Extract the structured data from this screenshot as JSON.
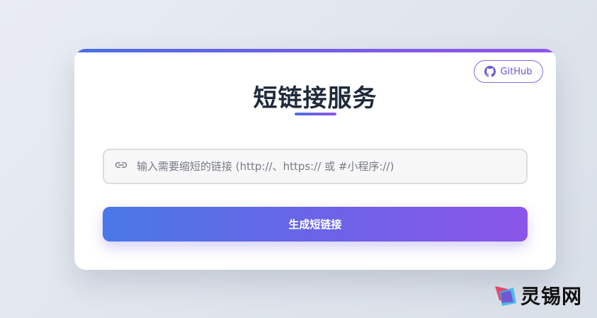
{
  "header": {
    "github_label": "GitHub",
    "title": "短链接服务"
  },
  "form": {
    "url_placeholder": "输入需要缩短的链接 (http://、https:// 或 #小程序://)",
    "url_value": "",
    "submit_label": "生成短链接"
  },
  "watermark": {
    "text": "灵锡网"
  },
  "colors": {
    "accent_start": "#4a78e6",
    "accent_end": "#8a55e8",
    "github_border": "#7b6ee0",
    "title": "#1f2a3a"
  },
  "icons": {
    "github": "github-icon",
    "link": "link-icon",
    "logo": "watermark-logo-icon"
  }
}
